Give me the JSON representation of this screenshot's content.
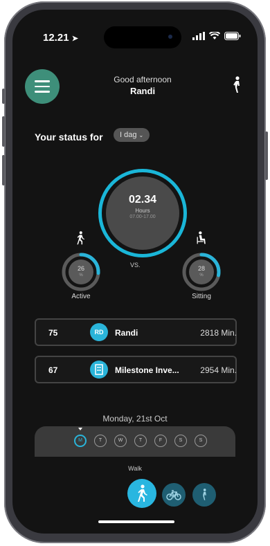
{
  "status_bar": {
    "time": "12.21"
  },
  "header": {
    "greeting": "Good afternoon",
    "name": "Randi"
  },
  "status": {
    "label": "Your status for",
    "period": "I dag"
  },
  "main_ring": {
    "value": "02.34",
    "unit": "Hours",
    "range": "07.00-17.00",
    "progress": 0.9
  },
  "vs_label": "VS.",
  "active": {
    "value": "26",
    "unit": "%",
    "label": "Active",
    "progress": 0.26,
    "color": "#2ab4d9"
  },
  "sitting": {
    "value": "28",
    "unit": "%",
    "label": "Sitting",
    "progress": 0.28,
    "color": "#2ab4d9"
  },
  "leaderboard": [
    {
      "rank": "75",
      "avatar": "RD",
      "name": "Randi",
      "minutes": "2818 Min."
    },
    {
      "rank": "67",
      "avatar": "",
      "name": "Milestone Inve...",
      "minutes": "2954 Min."
    }
  ],
  "date": "Monday, 21st Oct",
  "days": [
    "M",
    "T",
    "W",
    "T",
    "F",
    "S",
    "S"
  ],
  "activity": {
    "label": "Walk"
  },
  "colors": {
    "accent": "#2ab4d9",
    "menu": "#3e8f7a",
    "background": "#131313"
  }
}
